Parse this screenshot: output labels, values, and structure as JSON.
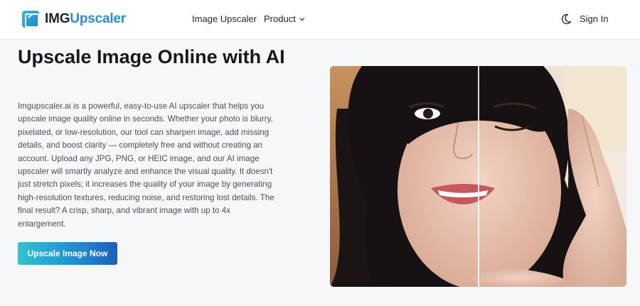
{
  "header": {
    "logo_part1": "IMG",
    "logo_part2": "Upscaler",
    "nav": {
      "image_upscaler": "Image Upscaler",
      "product": "Product"
    },
    "sign_in": "Sign In"
  },
  "hero": {
    "title": "Upscale Image Online with AI",
    "description": "Imgupscaler.ai is a powerful, easy-to-use AI upscaler that helps you upscale image quality online in seconds. Whether your photo is blurry, pixelated, or low-resolution, our tool can sharpen image, add missing details, and boost clarity — completely free and without creating an account. Upload any JPG, PNG, or HEIC image, and our AI image upscaler will smartly analyze and enhance the visual quality. It doesn't just stretch pixels; it increases the quality of your image by generating high-resolution textures, reducing noise, and restoring lost details. The final result? A crisp, sharp, and vibrant image with up to 4x enlargement.",
    "cta_label": "Upscale Image Now"
  },
  "colors": {
    "brand_blue": "#2a8fd0",
    "brand_teal": "#31c3cf",
    "cta_dark": "#1c5fb8"
  },
  "icons": {
    "logo": "logo-icon",
    "product_dropdown": "chevron-down-icon",
    "theme_toggle": "moon-icon"
  }
}
